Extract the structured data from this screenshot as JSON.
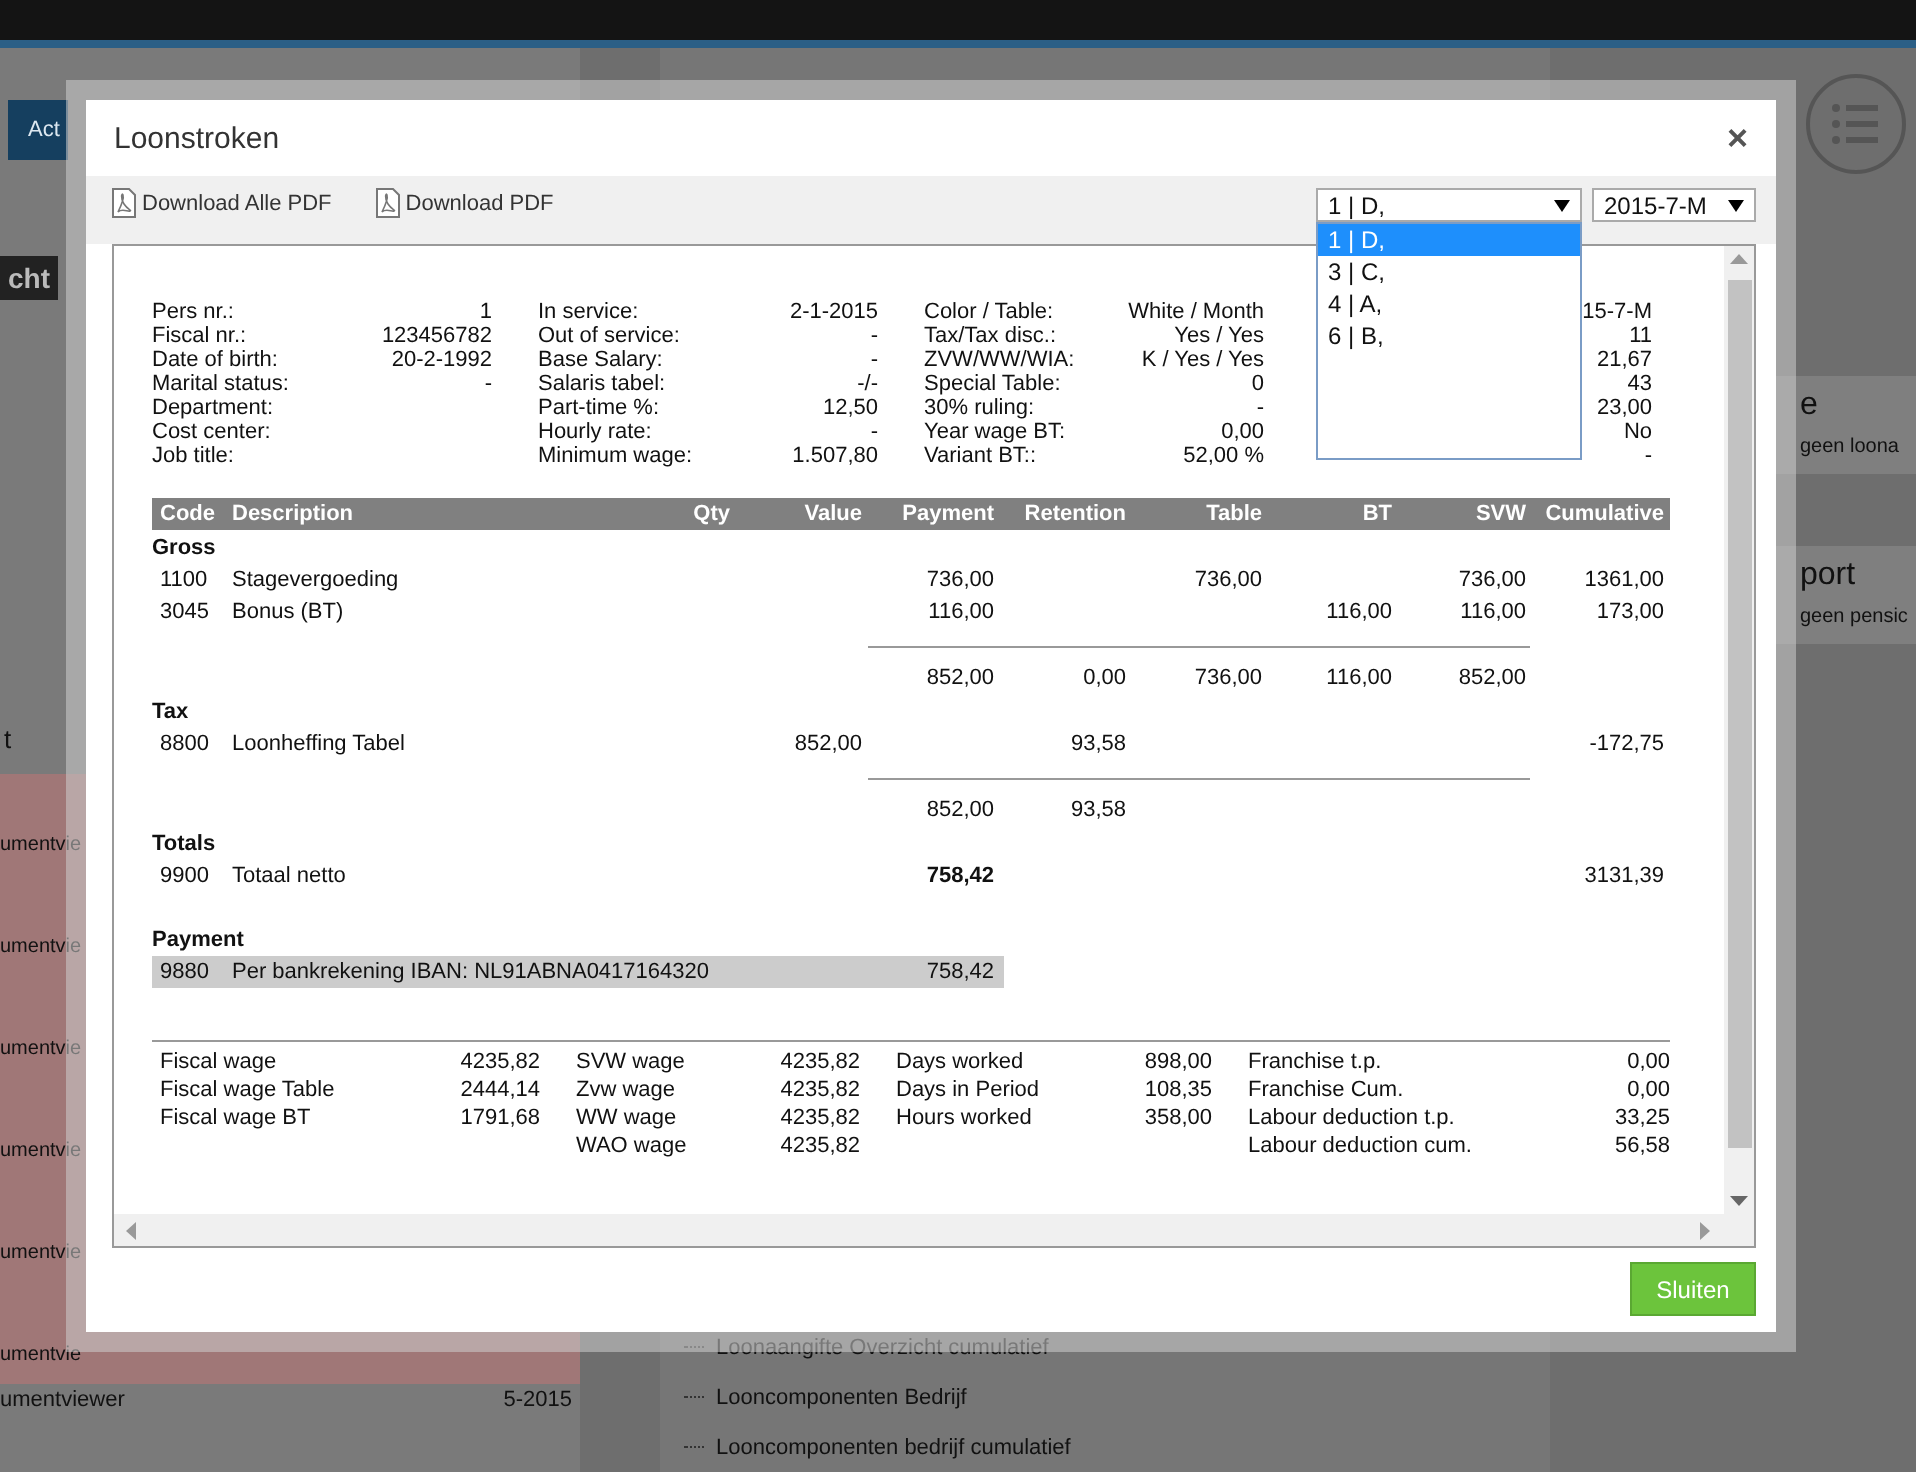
{
  "background": {
    "top_button": "Act",
    "tag": "cht",
    "left_heading": "t",
    "left_items": [
      "umentvie",
      "umentvie",
      "umentvie",
      "umentvie",
      "umentvie",
      "umentvie"
    ],
    "left_last_item": "umentviewer",
    "left_last_date": "5-2015",
    "tree_items": [
      "Loonaangifte Overzicht cumulatief",
      "Looncomponenten Bedrijf",
      "Looncomponenten bedrijf cumulatief"
    ],
    "right_cards": [
      {
        "title": "e",
        "text": "geen loona"
      },
      {
        "title": "port",
        "text": "geen pensic"
      }
    ]
  },
  "window": {
    "title": "Loonstroken",
    "close": "×"
  },
  "toolbar": {
    "downloads": [
      "Download Alle PDF",
      "Download PDF"
    ],
    "employee_select": {
      "value": "1 | D,",
      "expanded": true,
      "options": [
        {
          "label": "1 | D,",
          "selected": true
        },
        {
          "label": "3 | C,",
          "selected": false
        },
        {
          "label": "4 | A,",
          "selected": false
        },
        {
          "label": "6 | B,",
          "selected": false
        }
      ]
    },
    "period_select": {
      "value": "2015-7-M"
    }
  },
  "employee_info": {
    "columns": [
      [
        {
          "label": "Pers nr.:",
          "value": "1"
        },
        {
          "label": "Fiscal nr.:",
          "value": "123456782"
        },
        {
          "label": "Date of birth:",
          "value": "20-2-1992"
        },
        {
          "label": "Marital status:",
          "value": "-"
        },
        {
          "label": "Department:"
        },
        {
          "label": "Cost center:"
        },
        {
          "label": "Job title:"
        }
      ],
      [
        {
          "label": "In service:",
          "value": "2-1-2015"
        },
        {
          "label": "Out of service:",
          "value": "-"
        },
        {
          "label": "Base Salary:",
          "value": "-"
        },
        {
          "label": "Salaris tabel:",
          "value": "-/-"
        },
        {
          "label": "Part-time %:",
          "value": "12,50"
        },
        {
          "label": "Hourly rate:",
          "value": "-"
        },
        {
          "label": "Minimum wage:",
          "value": "1.507,80"
        }
      ],
      [
        {
          "label": "Color / Table:",
          "value": "White / Month"
        },
        {
          "label": "Tax/Tax disc.:",
          "value": "Yes / Yes"
        },
        {
          "label": "ZVW/WW/WIA:",
          "value": "K / Yes / Yes"
        },
        {
          "label": "Special Table:",
          "value": "0"
        },
        {
          "label": "30% ruling:",
          "value": "-"
        },
        {
          "label": "Year wage BT:",
          "value": "0,00"
        },
        {
          "label": "Variant BT::",
          "value": "52,00 %"
        }
      ]
    ],
    "column_4_values": [
      "15-7-M",
      "11",
      "21,67",
      "43",
      "23,00",
      "No",
      "-"
    ]
  },
  "payslip_table": {
    "columns": [
      "Code",
      "Description",
      "Qty",
      "Value",
      "Payment",
      "Retention",
      "Table",
      "BT",
      "SVW",
      "Cumulative"
    ],
    "sections": [
      {
        "title": "Gross",
        "rows": [
          {
            "code": "1100",
            "description": "Stagevergoeding",
            "payment": "736,00",
            "table": "736,00",
            "svw": "736,00",
            "cumulative": "1361,00",
            "highlighted": false,
            "emphasized": false
          },
          {
            "code": "3045",
            "description": "Bonus (BT)",
            "payment": "116,00",
            "bt": "116,00",
            "svw": "116,00",
            "cumulative": "173,00",
            "highlighted": false,
            "emphasized": false
          }
        ],
        "subtotal": {
          "payment": "852,00",
          "retention": "0,00",
          "table": "736,00",
          "bt": "116,00",
          "svw": "852,00"
        }
      },
      {
        "title": "Tax",
        "rows": [
          {
            "code": "8800",
            "description": "Loonheffing Tabel",
            "value": "852,00",
            "retention": "93,58",
            "cumulative": "-172,75",
            "highlighted": false,
            "emphasized": false
          }
        ],
        "subtotal": {
          "payment": "852,00",
          "retention": "93,58"
        }
      },
      {
        "title": "Totals",
        "rows": [
          {
            "code": "9900",
            "description": "Totaal netto",
            "payment": "758,42",
            "cumulative": "3131,39",
            "highlighted": false,
            "emphasized": true
          }
        ]
      },
      {
        "title": "Payment",
        "rows": [
          {
            "code": "9880",
            "description": "Per bankrekening IBAN: NL91ABNA0417164320",
            "payment": "758,42",
            "highlighted": true,
            "emphasized": false
          }
        ]
      }
    ]
  },
  "summary": {
    "groups": [
      [
        {
          "label": "Fiscal wage",
          "value": "4235,82"
        },
        {
          "label": "Fiscal wage Table",
          "value": "2444,14"
        },
        {
          "label": "Fiscal wage BT",
          "value": "1791,68"
        }
      ],
      [
        {
          "label": "SVW wage",
          "value": "4235,82"
        },
        {
          "label": "Zvw wage",
          "value": "4235,82"
        },
        {
          "label": "WW wage",
          "value": "4235,82"
        },
        {
          "label": "WAO wage",
          "value": "4235,82"
        }
      ],
      [
        {
          "label": "Days worked",
          "value": "898,00"
        },
        {
          "label": "Days in Period",
          "value": "108,35"
        },
        {
          "label": "Hours worked",
          "value": "358,00"
        }
      ],
      [
        {
          "label": "Franchise t.p.",
          "value": "0,00"
        },
        {
          "label": "Franchise Cum.",
          "value": "0,00"
        },
        {
          "label": "Labour deduction t.p.",
          "value": "33,25"
        },
        {
          "label": "Labour deduction cum.",
          "value": "56,58"
        }
      ]
    ]
  },
  "buttons": [
    {
      "label": "Sluiten"
    }
  ]
}
